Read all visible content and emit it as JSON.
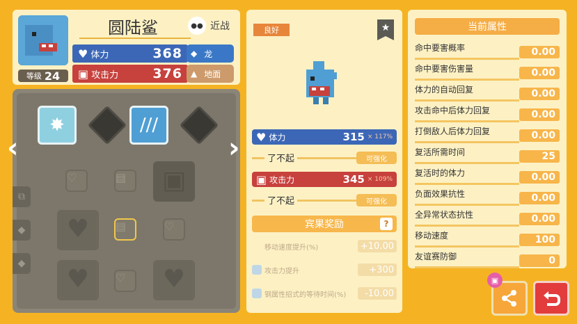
{
  "header": {
    "name": "圆陆鲨",
    "level_label": "等级",
    "level": "24",
    "recent_label": "近战",
    "stats": {
      "hp_label": "体力",
      "hp_value": "368",
      "atk_label": "攻击力",
      "atk_value": "376"
    },
    "types": [
      "龙",
      "地面"
    ]
  },
  "middle": {
    "rank": "良好",
    "hp_label": "体力",
    "hp_value": "315",
    "hp_pct": "× 117%",
    "atk_label": "攻击力",
    "atk_value": "345",
    "atk_pct": "× 109%",
    "hp_rating": "了不起",
    "atk_rating": "了不起",
    "enhance_label": "可强化",
    "bonus_title": "宾果奖励",
    "bonus_rows": [
      {
        "label": "移动速度提升(%)",
        "value": "+10.00"
      },
      {
        "label": "攻击力提升",
        "value": "+300"
      },
      {
        "label": "钢属性招式的等待时间(%)",
        "value": "-10.00"
      }
    ]
  },
  "right": {
    "title": "当前属性",
    "rows": [
      {
        "label": "命中要害概率",
        "value": "0.00"
      },
      {
        "label": "命中要害伤害量",
        "value": "0.00"
      },
      {
        "label": "体力的自动回复",
        "value": "0.00"
      },
      {
        "label": "攻击命中后体力回复",
        "value": "0.00"
      },
      {
        "label": "打倒敌人后体力回复",
        "value": "0.00"
      },
      {
        "label": "复活所需时间",
        "value": "25"
      },
      {
        "label": "复活时的体力",
        "value": "0.00"
      },
      {
        "label": "负面效果抗性",
        "value": "0.00"
      },
      {
        "label": "全异常状态抗性",
        "value": "0.00"
      },
      {
        "label": "移动速度",
        "value": "100"
      },
      {
        "label": "友谊赛防御",
        "value": "0"
      }
    ]
  },
  "colors": {
    "background": "#f5b323",
    "hp": "#3c67b7",
    "atk": "#c7413d",
    "dragon": "#3a78c7",
    "ground": "#cd9a6b"
  }
}
